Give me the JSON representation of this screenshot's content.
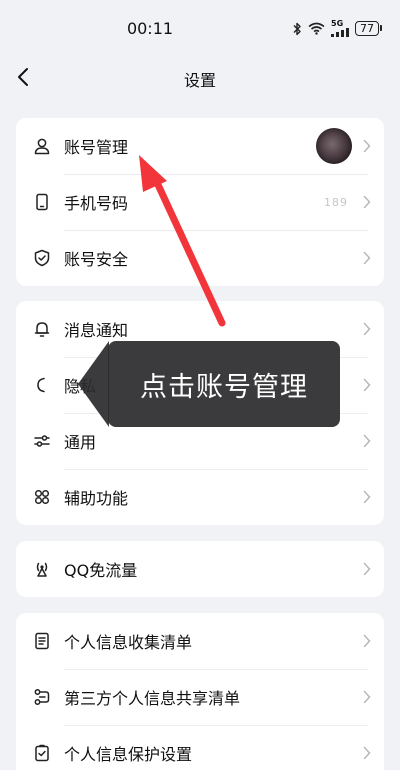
{
  "status": {
    "time": "00:11",
    "network": "5G",
    "battery": "77"
  },
  "header": {
    "title": "设置"
  },
  "group1": [
    {
      "label": "账号管理",
      "value": "",
      "icon": "person-icon"
    },
    {
      "label": "手机号码",
      "value": "189",
      "icon": "phone-icon"
    },
    {
      "label": "账号安全",
      "value": "",
      "icon": "shield-check-icon"
    }
  ],
  "group2": [
    {
      "label": "消息通知",
      "icon": "bell-icon"
    },
    {
      "label": "隐私",
      "icon": "moon-icon"
    },
    {
      "label": "通用",
      "icon": "sliders-icon"
    },
    {
      "label": "辅助功能",
      "icon": "grid-loops-icon"
    }
  ],
  "group3": [
    {
      "label": "QQ免流量",
      "icon": "antenna-icon"
    }
  ],
  "group4": [
    {
      "label": "个人信息收集清单",
      "icon": "document-list-icon"
    },
    {
      "label": "第三方个人信息共享清单",
      "icon": "share-nodes-icon"
    },
    {
      "label": "个人信息保护设置",
      "icon": "clipboard-check-icon"
    }
  ],
  "overlay": {
    "tooltip_text": "点击账号管理",
    "arrow_color": "#f2353b"
  }
}
